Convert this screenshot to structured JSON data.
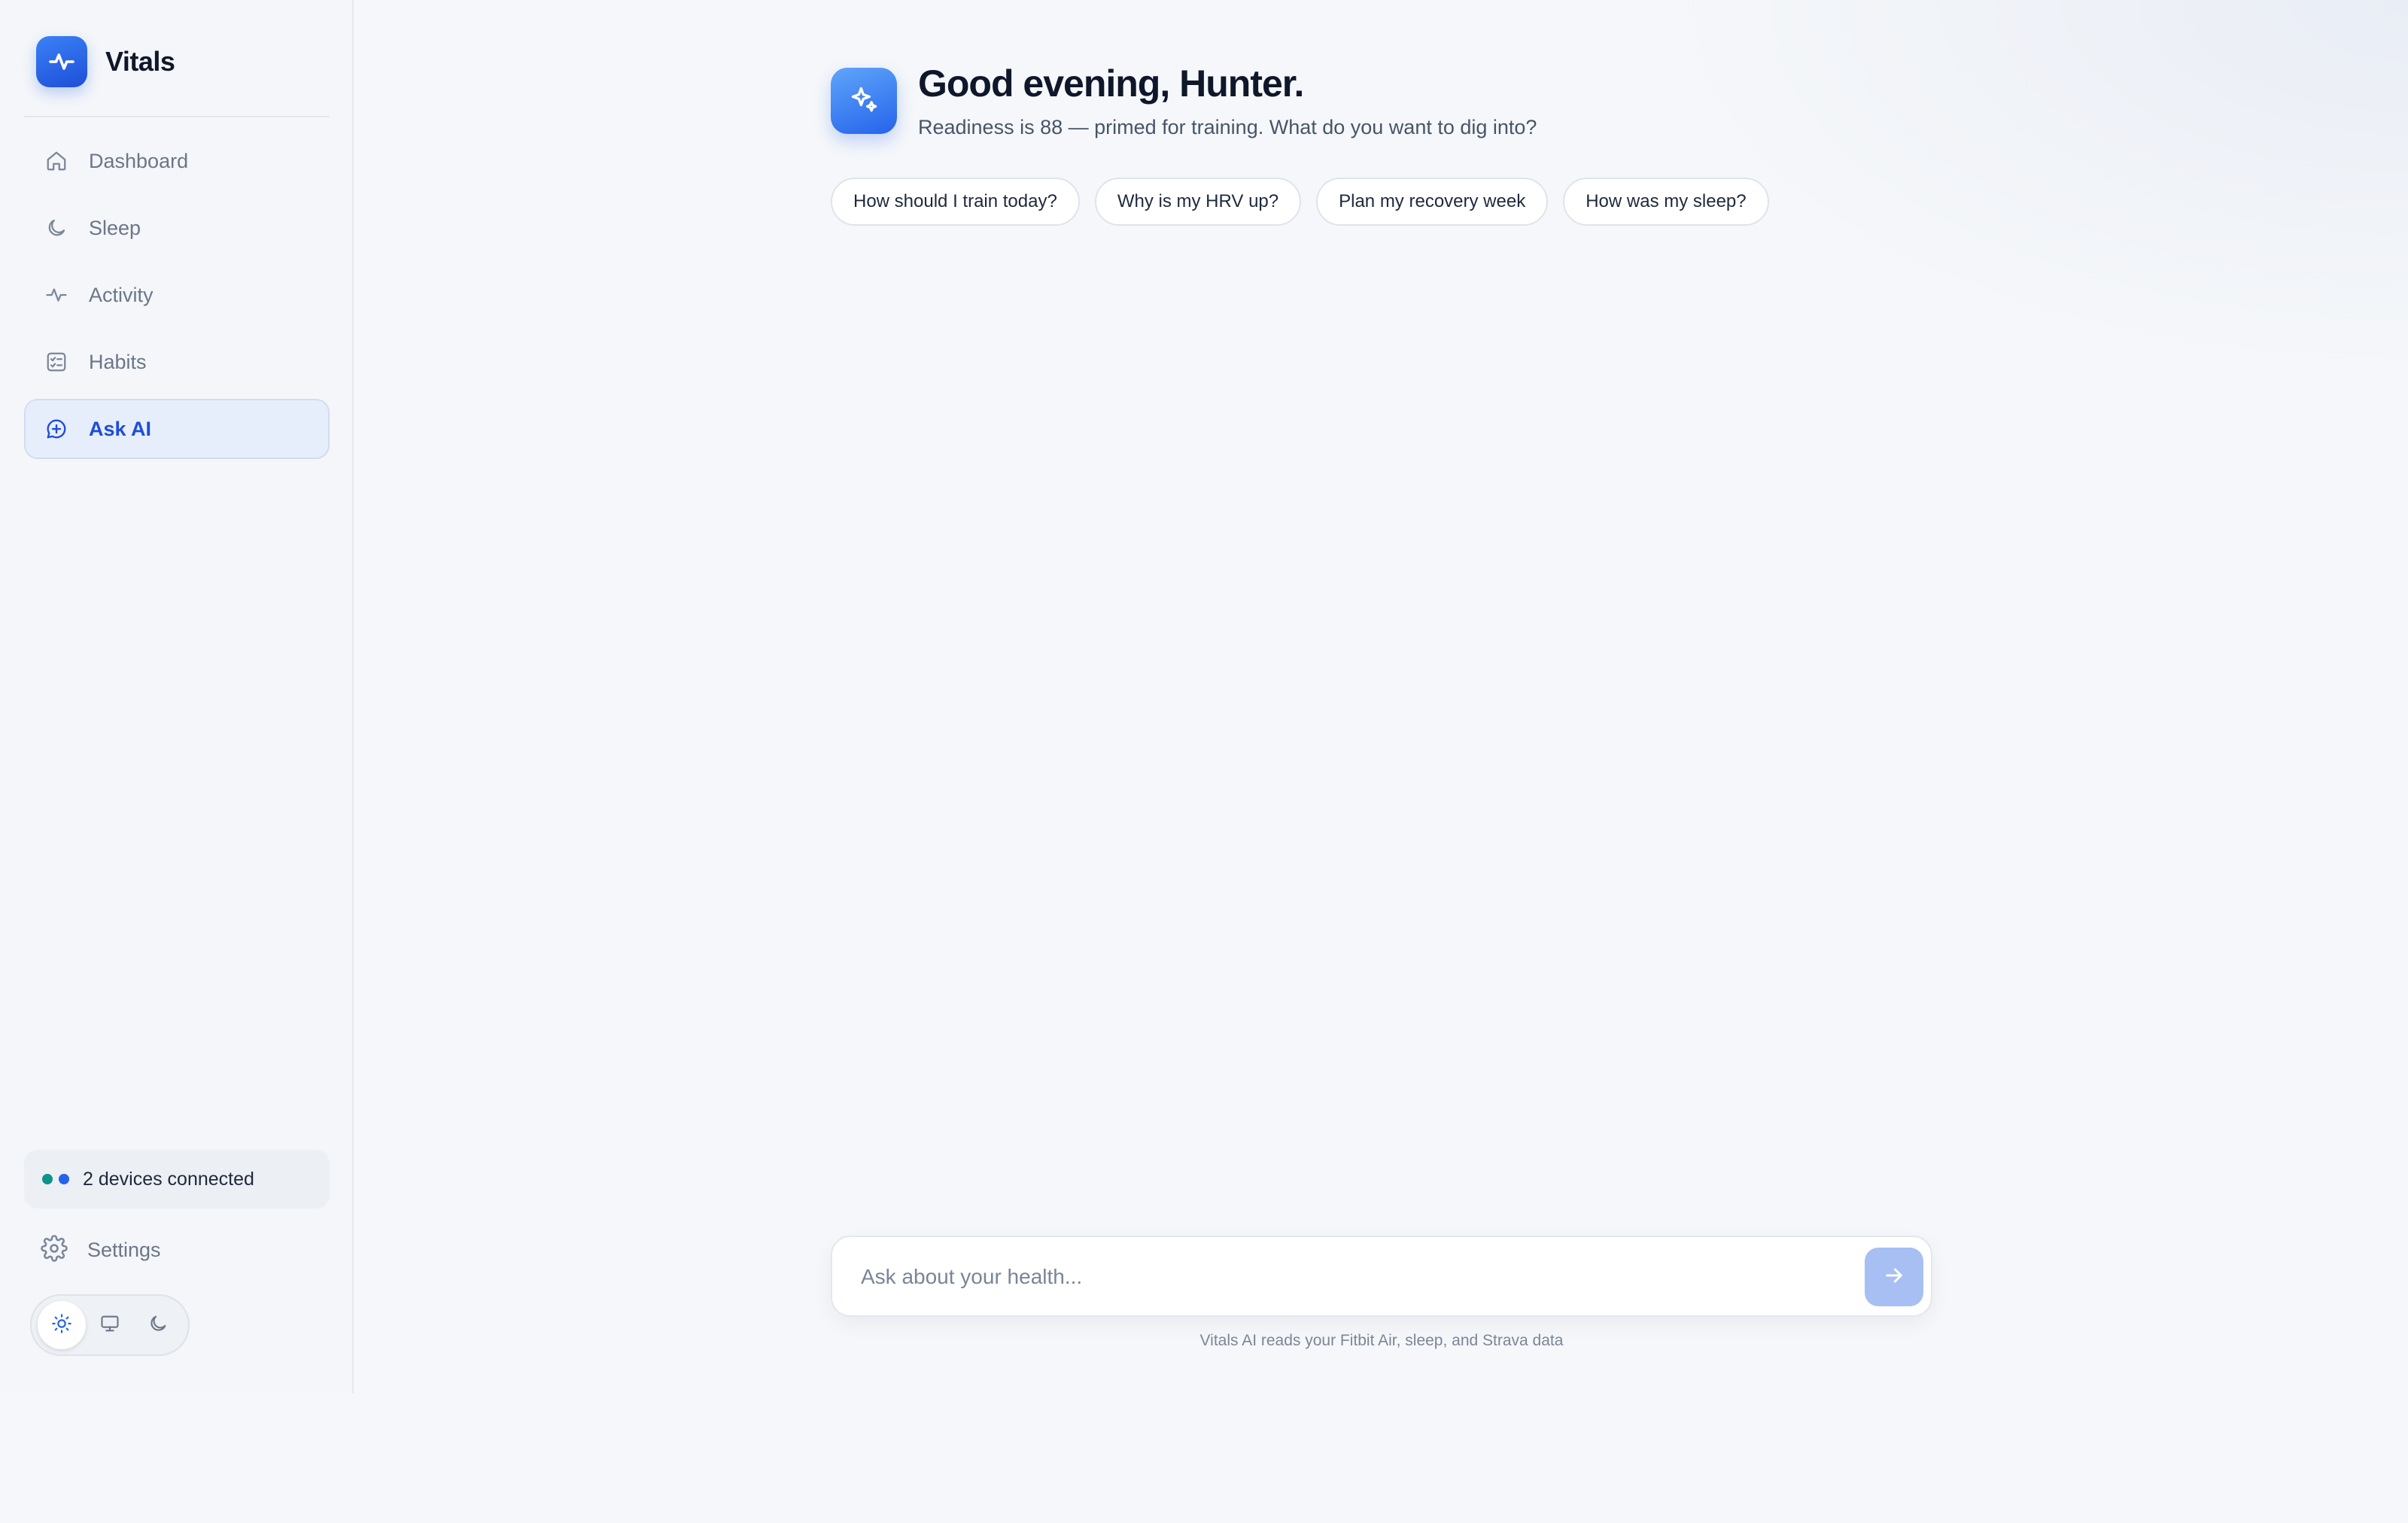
{
  "app": {
    "name": "Vitals",
    "logo_icon": "pulse-icon"
  },
  "sidebar": {
    "items": [
      {
        "label": "Dashboard",
        "icon": "home-icon",
        "active": false
      },
      {
        "label": "Sleep",
        "icon": "moon-icon",
        "active": false
      },
      {
        "label": "Activity",
        "icon": "activity-icon",
        "active": false
      },
      {
        "label": "Habits",
        "icon": "checklist-icon",
        "active": false
      },
      {
        "label": "Ask AI",
        "icon": "chat-sparkle-icon",
        "active": true
      }
    ],
    "devices": {
      "label": "2 devices connected",
      "dot_colors": [
        "#0d9488",
        "#2563eb"
      ]
    },
    "settings_label": "Settings",
    "theme": {
      "options": [
        "light",
        "system",
        "dark"
      ],
      "selected": "light"
    }
  },
  "main": {
    "greeting": "Good evening, Hunter.",
    "subtitle": "Readiness is 88 — primed for training. What do you want to dig into?",
    "suggestions": [
      "How should I train today?",
      "Why is my HRV up?",
      "Plan my recovery week",
      "How was my sleep?"
    ],
    "composer": {
      "placeholder": "Ask about your health...",
      "value": ""
    },
    "footnote": "Vitals AI reads your Fitbit Air, sleep, and Strava data"
  },
  "colors": {
    "accent": "#2563eb",
    "accent_active_bg": "#e7eefb",
    "send_disabled": "#a7bff3"
  }
}
